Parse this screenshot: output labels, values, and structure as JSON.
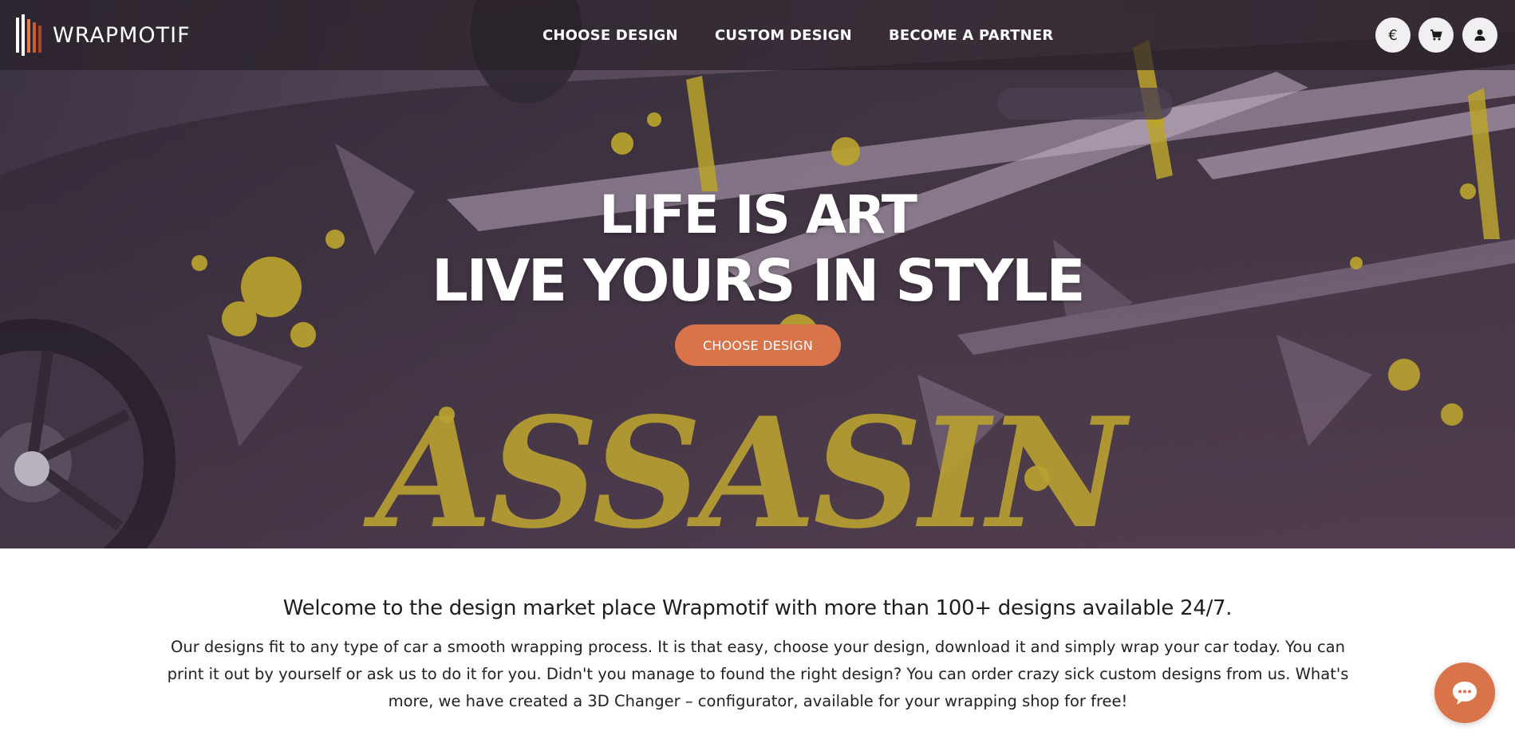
{
  "brand": {
    "name": "WRAPMOTIF"
  },
  "nav": {
    "items": [
      "CHOOSE DESIGN",
      "CUSTOM DESIGN",
      "BECOME A PARTNER"
    ],
    "icons": {
      "currency": "€",
      "cart": "cart-icon",
      "account": "user-icon"
    }
  },
  "hero": {
    "headline_line1": "LIFE IS ART",
    "headline_line2": "LIVE YOURS IN STYLE",
    "cta_label": "CHOOSE DESIGN",
    "background_text": "ASSASIN"
  },
  "content": {
    "welcome": "Welcome to the design market place Wrapmotif with more than 100+ designs available 24/7.",
    "description": "Our designs fit to any type of car a smooth wrapping process. It is that easy, choose your design, download it and simply wrap your car today. You can print it out by yourself or ask us to do it for you. Didn't you manage to found the right design? You can order crazy sick custom designs from us. What's more, we have created a 3D Changer – configurator, available for your wrapping shop for free!"
  },
  "colors": {
    "accent": "#d9744a",
    "nav_bg": "#282028",
    "text": "#222222",
    "art_yellow": "#d9c225"
  },
  "chat": {
    "icon": "chat-bubble-icon"
  }
}
